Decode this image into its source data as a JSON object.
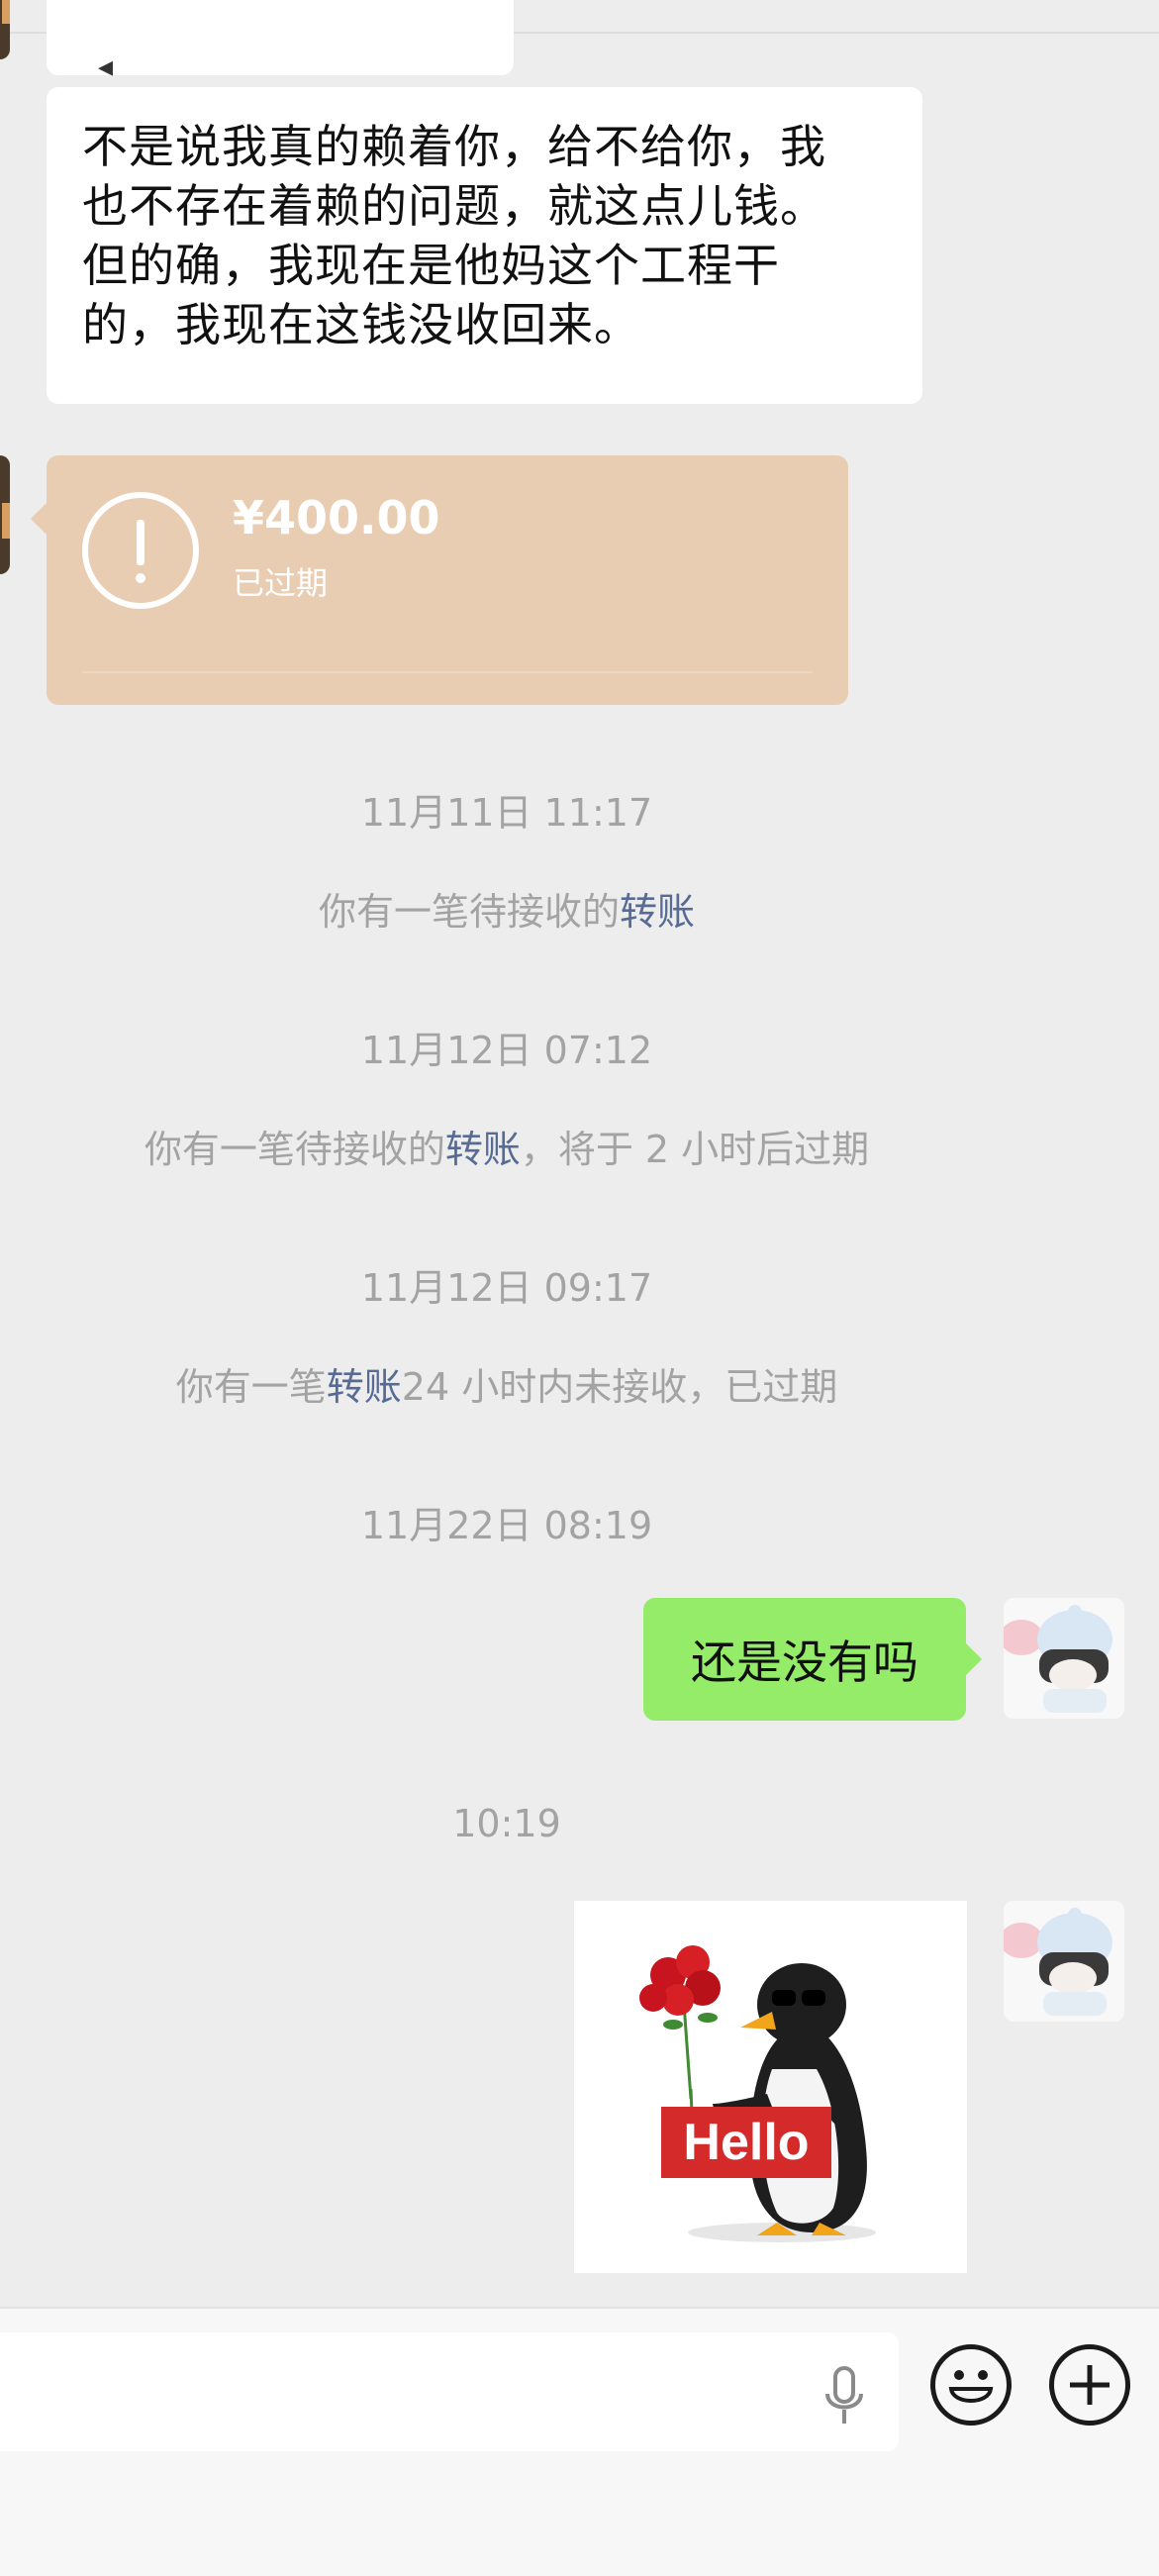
{
  "messages": {
    "incoming_text_lines": [
      "不是说我真的赖着你，给不给你，我",
      "也不存在着赖的问题，就这点儿钱。",
      "但的确，我现在是他妈这个工程干",
      "的，我现在这钱没收回来。"
    ],
    "transfer": {
      "amount": "¥400.00",
      "status": "已过期",
      "icon": "exclamation-circle-icon"
    },
    "events": [
      {
        "time": "11月11日 11:17",
        "pre": "你有一笔待接收的",
        "link": "转账",
        "post": ""
      },
      {
        "time": "11月12日 07:12",
        "pre": "你有一笔待接收的",
        "link": "转账",
        "post": "，将于 2 小时后过期"
      },
      {
        "time": "11月12日 09:17",
        "pre": "你有一笔",
        "link": "转账",
        "post": "24 小时内未接收，已过期"
      }
    ],
    "outgoing_time": "11月22日 08:19",
    "outgoing_text": "还是没有吗",
    "sticker_time": "10:19",
    "sticker_text": "Hello"
  },
  "input_bar": {
    "icons": [
      "microphone-icon",
      "emoji-icon",
      "plus-icon"
    ]
  },
  "colors": {
    "background": "#ededed",
    "outgoing_bubble": "#95ec69",
    "transfer_card": "#e8cdb2",
    "link": "#576b95"
  }
}
